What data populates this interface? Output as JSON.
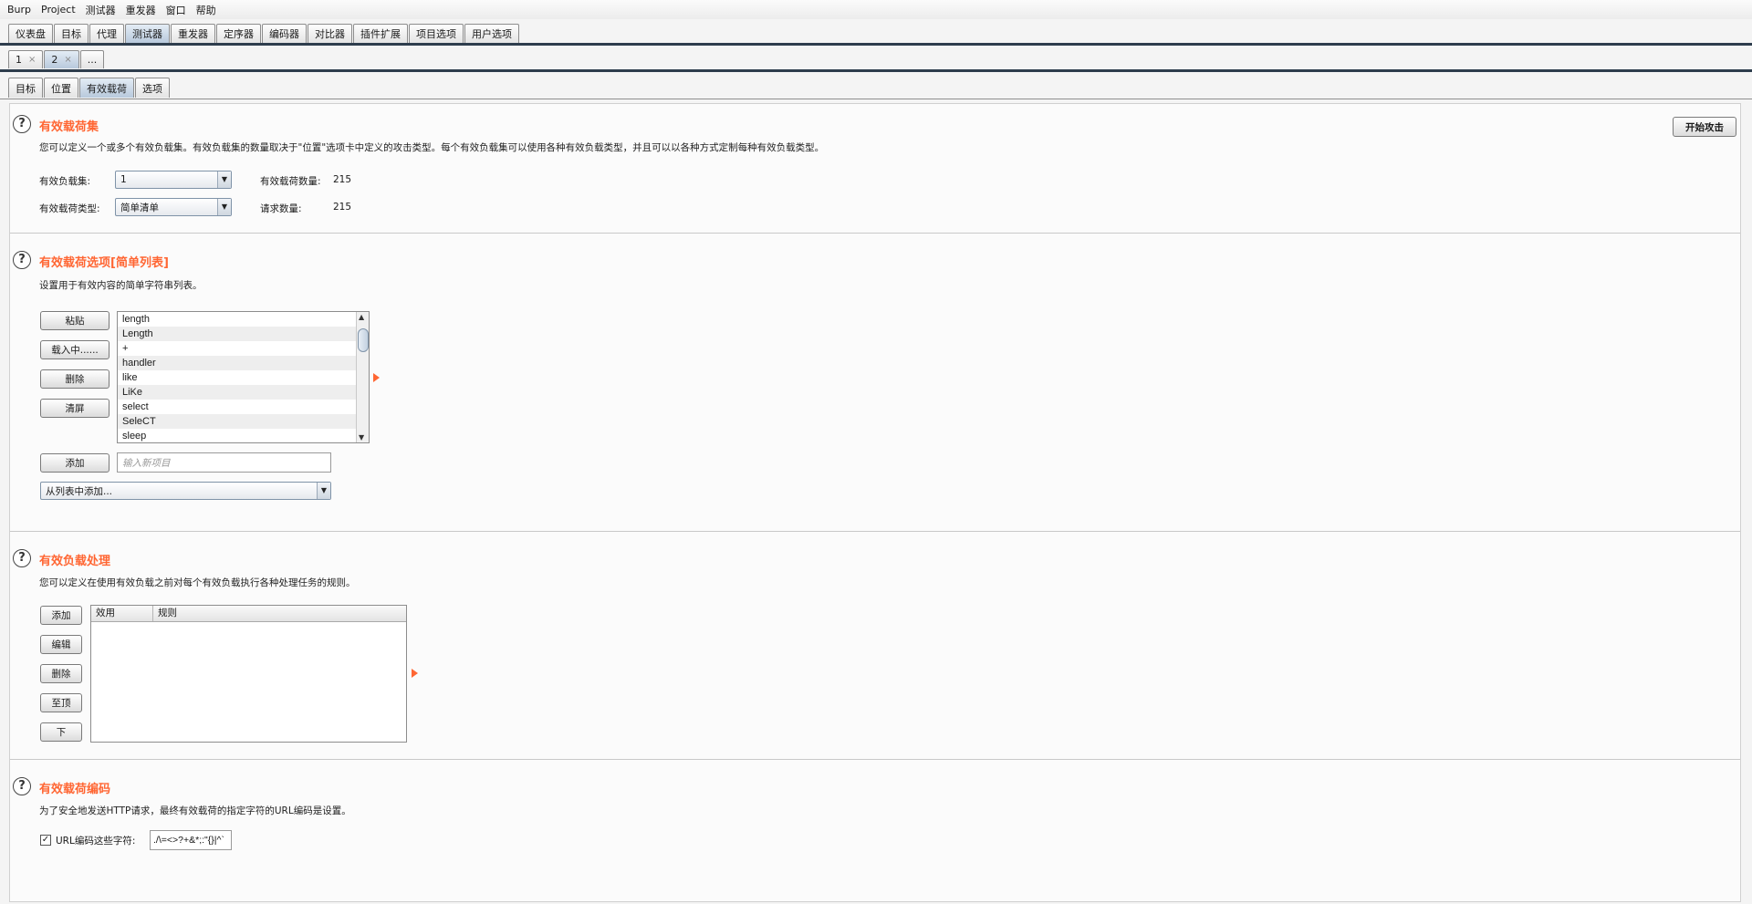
{
  "menu": [
    "Burp",
    "Project",
    "测试器",
    "重发器",
    "窗口",
    "帮助"
  ],
  "main_tabs": [
    "仪表盘",
    "目标",
    "代理",
    "测试器",
    "重发器",
    "定序器",
    "编码器",
    "对比器",
    "插件扩展",
    "项目选项",
    "用户选项"
  ],
  "attack_tabs": [
    {
      "label": "1",
      "close": "×"
    },
    {
      "label": "2",
      "close": "×"
    },
    {
      "label": "...",
      "close": ""
    }
  ],
  "intruder_tabs": [
    "目标",
    "位置",
    "有效载荷",
    "选项"
  ],
  "payload_sets": {
    "title": "有效载荷集",
    "desc": "您可以定义一个或多个有效负载集。有效负载集的数量取决于\"位置\"选项卡中定义的攻击类型。每个有效负载集可以使用各种有效负载类型，并且可以以各种方式定制每种有效负载类型。",
    "set_label": "有效负载集:",
    "set_value": "1",
    "type_label": "有效载荷类型:",
    "type_value": "简单清单",
    "count_label": "有效载荷数量:",
    "count_value": "215",
    "requests_label": "请求数量:",
    "requests_value": "215",
    "start_attack": "开始攻击"
  },
  "payload_options": {
    "title": "有效载荷选项[简单列表]",
    "desc": "设置用于有效内容的简单字符串列表。",
    "paste": "粘贴",
    "load": "载入中......",
    "remove": "删除",
    "clear": "清屏",
    "add": "添加",
    "add_placeholder": "输入新项目",
    "add_from_list": "从列表中添加...",
    "items": [
      "length",
      "Length",
      "+",
      "handler",
      "like",
      "LiKe",
      "select",
      "SeleCT",
      "sleep"
    ]
  },
  "payload_processing": {
    "title": "有效负载处理",
    "desc": "您可以定义在使用有效负载之前对每个有效负载执行各种处理任务的规则。",
    "add": "添加",
    "edit": "编辑",
    "remove": "删除",
    "up": "至顶",
    "down": "下",
    "col_enabled": "效用",
    "col_rule": "规则"
  },
  "payload_encoding": {
    "title": "有效载荷编码",
    "desc": "为了安全地发送HTTP请求，最终有效载荷的指定字符的URL编码是设置。",
    "checkbox_label": "URL编码这些字符:",
    "checked": true,
    "chars": "./\\=<>?+&*;:\"{}|^`"
  }
}
